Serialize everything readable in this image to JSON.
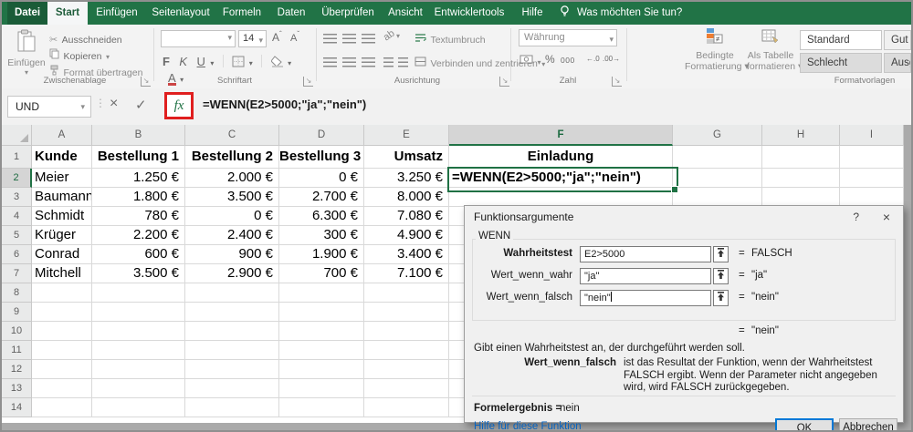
{
  "tabs": {
    "items": [
      {
        "label": "Datei",
        "style": "file"
      },
      {
        "label": "Start",
        "style": "active"
      },
      {
        "label": "Einfügen"
      },
      {
        "label": "Seitenlayout"
      },
      {
        "label": "Formeln"
      },
      {
        "label": "Daten"
      },
      {
        "label": "Überprüfen"
      },
      {
        "label": "Ansicht"
      },
      {
        "label": "Entwicklertools"
      },
      {
        "label": "Hilfe"
      }
    ],
    "tell_me": "Was möchten Sie tun?"
  },
  "ribbon": {
    "clipboard": {
      "group": "Zwischenablage",
      "paste": "Einfügen",
      "cut": "Ausschneiden",
      "copy": "Kopieren",
      "format_painter": "Format übertragen"
    },
    "font": {
      "group": "Schriftart",
      "size": "14",
      "bold": "F",
      "italic": "K",
      "underline": "U"
    },
    "alignment": {
      "group": "Ausrichtung",
      "wrap": "Textumbruch",
      "merge": "Verbinden und zentrieren"
    },
    "number": {
      "group": "Zahl",
      "format": "Währung",
      "percent": "%",
      "thousands": "000"
    },
    "styles": {
      "group": "Formatvorlagen",
      "conditional_line1": "Bedingte",
      "conditional_line2": "Formatierung",
      "table_line1": "Als Tabelle",
      "table_line2": "formatieren",
      "gallery": [
        {
          "label": "Standard",
          "bg": "#ffffff"
        },
        {
          "label": "Gut",
          "bg": "#f0f0f0"
        },
        {
          "label": "Schlecht",
          "bg": "#dcdcdc"
        },
        {
          "label": "Ausg",
          "bg": "#dcdcdc"
        }
      ]
    }
  },
  "formula_bar": {
    "name_box": "UND",
    "fx": "fx",
    "cancel": "×",
    "enter": "✓",
    "formula": "=WENN(E2>5000;\"ja\";\"nein\")"
  },
  "sheet": {
    "columns": [
      "A",
      "B",
      "C",
      "D",
      "E",
      "F",
      "G",
      "H",
      "I"
    ],
    "active_column": "F",
    "active_row": 2,
    "row_count": 14,
    "headers": [
      "Kunde",
      "Bestellung 1",
      "Bestellung 2",
      "Bestellung 3",
      "Umsatz",
      "Einladung"
    ],
    "rows": [
      [
        "Meier",
        "1.250 €",
        "2.000 €",
        "0 €",
        "3.250 €",
        "=WENN(E2>5000;\"ja\";\"nein\")"
      ],
      [
        "Baumann",
        "1.800 €",
        "3.500 €",
        "2.700 €",
        "8.000 €",
        ""
      ],
      [
        "Schmidt",
        "780 €",
        "0 €",
        "6.300 €",
        "7.080 €",
        ""
      ],
      [
        "Krüger",
        "2.200 €",
        "2.400 €",
        "300 €",
        "4.900 €",
        ""
      ],
      [
        "Conrad",
        "600 €",
        "900 €",
        "1.900 €",
        "3.400 €",
        ""
      ],
      [
        "Mitchell",
        "3.500 €",
        "2.900 €",
        "700 €",
        "7.100 €",
        ""
      ]
    ]
  },
  "dialog": {
    "title": "Funktionsargumente",
    "help_button": "?",
    "close_button": "×",
    "function_name": "WENN",
    "equals": "=",
    "args": [
      {
        "label": "Wahrheitstest",
        "value": "E2>5000",
        "result": "FALSCH",
        "bold": true
      },
      {
        "label": "Wert_wenn_wahr",
        "value": "\"ja\"",
        "result": "\"ja\""
      },
      {
        "label": "Wert_wenn_falsch",
        "value": "\"nein\"",
        "result": "\"nein\"",
        "cursor": true
      }
    ],
    "overall_result": "\"nein\"",
    "description": "Gibt einen Wahrheitstest an, der durchgeführt werden soll.",
    "arg_help_label": "Wert_wenn_falsch",
    "arg_help_text": "ist das Resultat der Funktion, wenn der Wahrheitstest FALSCH ergibt. Wenn der Parameter nicht angegeben wird, wird FALSCH zurückgegeben.",
    "formula_result_label": "Formelergebnis =",
    "formula_result": "nein",
    "help_link": "Hilfe für diese Funktion",
    "ok": "OK",
    "cancel": "Abbrechen"
  }
}
